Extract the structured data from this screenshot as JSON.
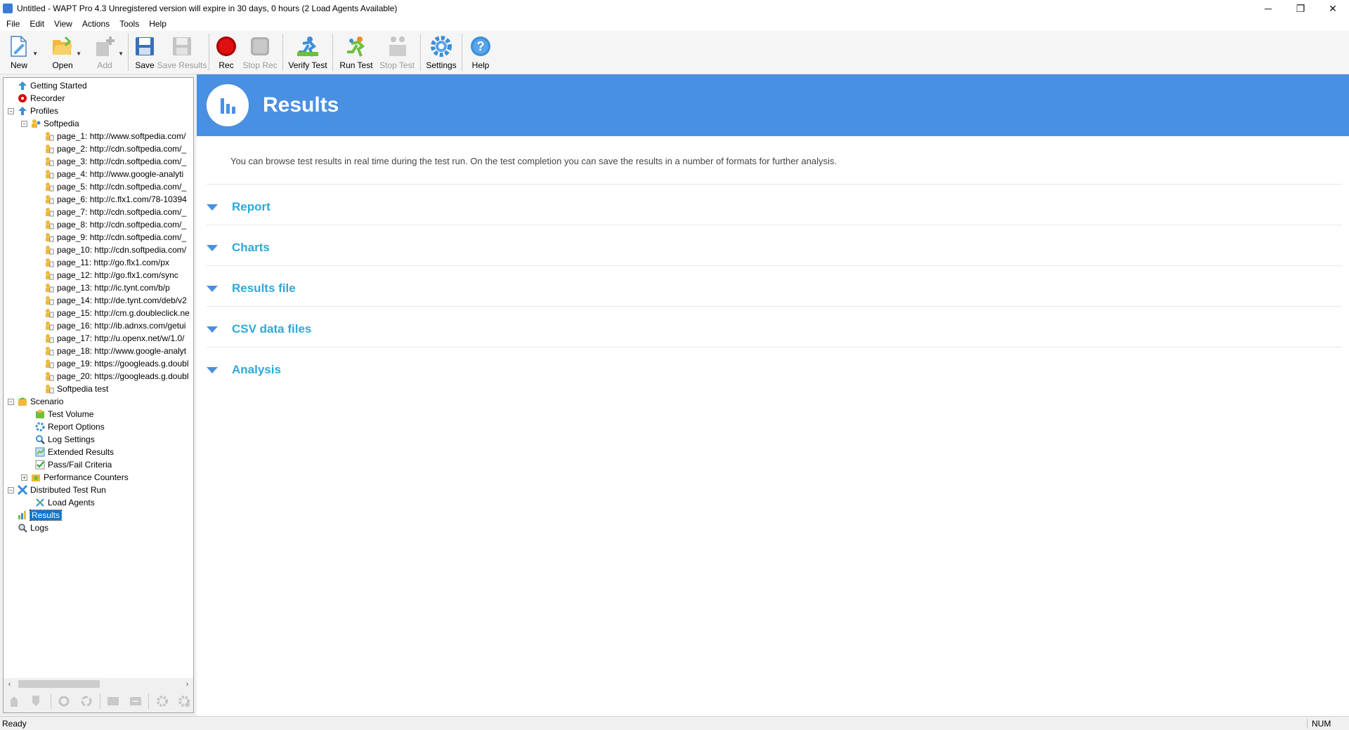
{
  "window": {
    "title": "Untitled - WAPT Pro 4.3  Unregistered version will expire in 30 days, 0 hours (2 Load Agents Available)",
    "minimize": "─",
    "restore": "❐",
    "close": "✕"
  },
  "menu": [
    "File",
    "Edit",
    "View",
    "Actions",
    "Tools",
    "Help"
  ],
  "toolbar": {
    "new": "New",
    "open": "Open",
    "add": "Add",
    "save": "Save",
    "save_results": "Save Results",
    "rec": "Rec",
    "stop_rec": "Stop Rec",
    "verify_test": "Verify Test",
    "run_test": "Run Test",
    "stop_test": "Stop Test",
    "settings": "Settings",
    "help": "Help"
  },
  "tree": {
    "getting_started": "Getting Started",
    "recorder": "Recorder",
    "profiles": "Profiles",
    "profile_name": "Softpedia",
    "pages": [
      "page_1: http://www.softpedia.com/",
      "page_2: http://cdn.softpedia.com/_",
      "page_3: http://cdn.softpedia.com/_",
      "page_4: http://www.google-analyti",
      "page_5: http://cdn.softpedia.com/_",
      "page_6: http://c.flx1.com/78-10394",
      "page_7: http://cdn.softpedia.com/_",
      "page_8: http://cdn.softpedia.com/_",
      "page_9: http://cdn.softpedia.com/_",
      "page_10: http://cdn.softpedia.com/",
      "page_11: http://go.flx1.com/px",
      "page_12: http://go.flx1.com/sync",
      "page_13: http://ic.tynt.com/b/p",
      "page_14: http://de.tynt.com/deb/v2",
      "page_15: http://cm.g.doubleclick.ne",
      "page_16: http://ib.adnxs.com/getui",
      "page_17: http://u.openx.net/w/1.0/",
      "page_18: http://www.google-analyt",
      "page_19: https://googleads.g.doubl",
      "page_20: https://googleads.g.doubl",
      "Softpedia test"
    ],
    "scenario": "Scenario",
    "scenario_items": [
      "Test Volume",
      "Report Options",
      "Log Settings",
      "Extended Results",
      "Pass/Fail Criteria",
      "Performance Counters"
    ],
    "distributed": "Distributed Test Run",
    "load_agents": "Load Agents",
    "results": "Results",
    "logs": "Logs"
  },
  "content": {
    "title": "Results",
    "description": "You can browse test results in real time during the test run. On the test completion you can save the results in a number of formats for further analysis.",
    "sections": [
      "Report",
      "Charts",
      "Results file",
      "CSV data files",
      "Analysis"
    ]
  },
  "status": {
    "text": "Ready",
    "num": "NUM"
  },
  "colors": {
    "banner": "#4a90e2",
    "section_text": "#2fa8d8",
    "selection": "#0078d7"
  }
}
